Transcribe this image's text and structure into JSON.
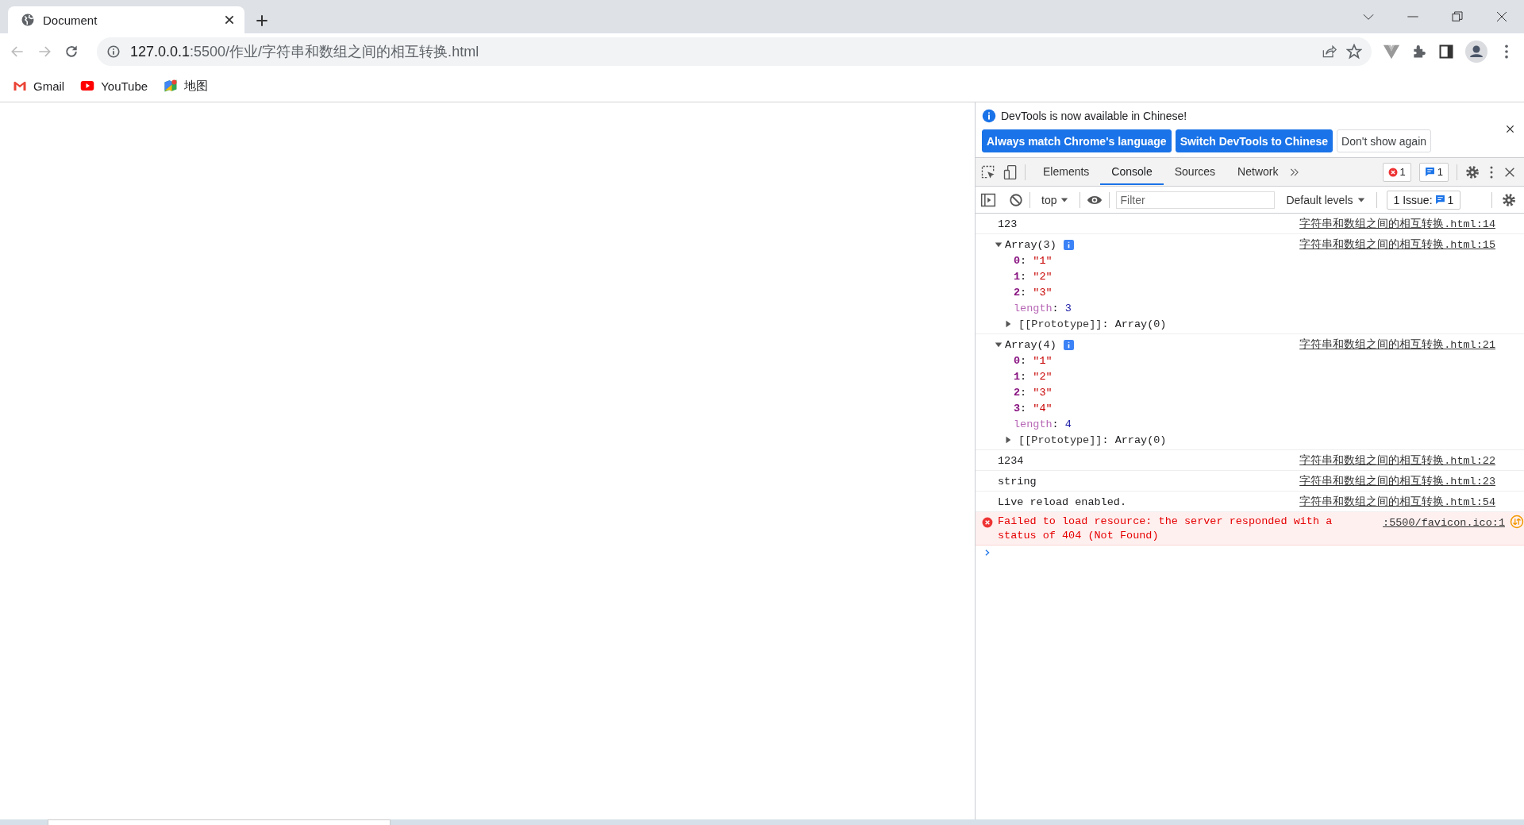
{
  "browser": {
    "tab": {
      "title": "Document"
    },
    "address": {
      "host": "127.0.0.1",
      "path": ":5500/作业/字符串和数组之间的相互转换.html"
    },
    "bookmarks": [
      {
        "label": "Gmail",
        "kind": "gmail"
      },
      {
        "label": "YouTube",
        "kind": "youtube"
      },
      {
        "label": "地图",
        "kind": "maps"
      }
    ]
  },
  "devtools": {
    "banner": {
      "message": "DevTools is now available in Chinese!",
      "buttons": [
        {
          "label": "Always match Chrome's language",
          "kind": "primary"
        },
        {
          "label": "Switch DevTools to Chinese",
          "kind": "primary"
        },
        {
          "label": "Don't show again",
          "kind": "secondary"
        }
      ]
    },
    "tabs": [
      {
        "label": "Elements",
        "selected": false
      },
      {
        "label": "Console",
        "selected": true
      },
      {
        "label": "Sources",
        "selected": false
      },
      {
        "label": "Network",
        "selected": false
      }
    ],
    "error_count": "1",
    "message_count": "1",
    "console_toolbar": {
      "context": "top",
      "filter_placeholder": "Filter",
      "levels": "Default levels",
      "issues_label": "1 Issue:",
      "issues_count": "1"
    },
    "messages": [
      {
        "kind": "log",
        "text": "123",
        "source": "字符串和数组之间的相互转换.html:14"
      },
      {
        "kind": "object",
        "header": "Array(3)",
        "expanded": true,
        "source": "字符串和数组之间的相互转换.html:15",
        "entries": [
          {
            "kind": "index",
            "key": "0",
            "sep": ":",
            "value": "\"1\""
          },
          {
            "kind": "index",
            "key": "1",
            "sep": ":",
            "value": "\"2\""
          },
          {
            "kind": "index",
            "key": "2",
            "sep": ":",
            "value": "\"3\""
          },
          {
            "kind": "length",
            "key": "length",
            "sep": ":",
            "value": "3"
          },
          {
            "kind": "prototype",
            "key": "[[Prototype]]",
            "sep": ":",
            "value": "Array(0)",
            "expanded": false
          }
        ]
      },
      {
        "kind": "object",
        "header": "Array(4)",
        "expanded": true,
        "source": "字符串和数组之间的相互转换.html:21",
        "entries": [
          {
            "kind": "index",
            "key": "0",
            "sep": ":",
            "value": "\"1\""
          },
          {
            "kind": "index",
            "key": "1",
            "sep": ":",
            "value": "\"2\""
          },
          {
            "kind": "index",
            "key": "2",
            "sep": ":",
            "value": "\"3\""
          },
          {
            "kind": "index",
            "key": "3",
            "sep": ":",
            "value": "\"4\""
          },
          {
            "kind": "length",
            "key": "length",
            "sep": ":",
            "value": "4"
          },
          {
            "kind": "prototype",
            "key": "[[Prototype]]",
            "sep": ":",
            "value": "Array(0)",
            "expanded": false
          }
        ]
      },
      {
        "kind": "log",
        "text": "1234",
        "source": "字符串和数组之间的相互转换.html:22"
      },
      {
        "kind": "log",
        "text": "string",
        "source": "字符串和数组之间的相互转换.html:23"
      },
      {
        "kind": "log",
        "text": "Live reload enabled.",
        "source": "字符串和数组之间的相互转换.html:54"
      },
      {
        "kind": "error",
        "text": "Failed to load resource: the server responded with a status of 404 (Not Found)",
        "source": ":5500/favicon.ico:1"
      }
    ]
  }
}
